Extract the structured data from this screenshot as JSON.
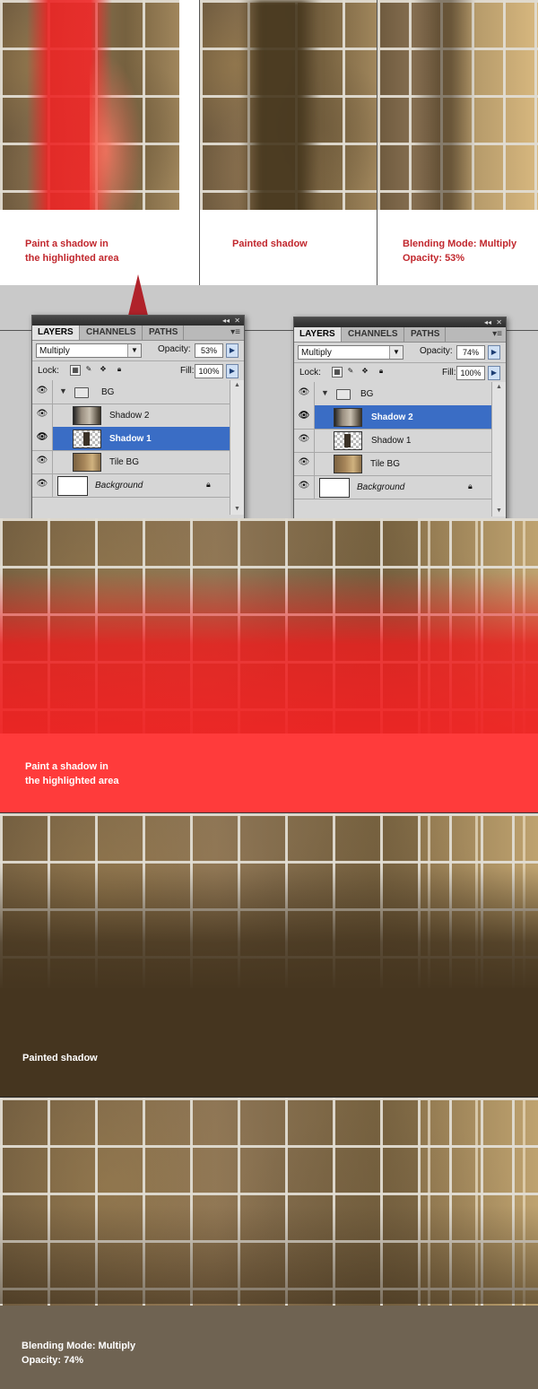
{
  "top_panels": [
    {
      "caption_lines": [
        "Paint a shadow in",
        "the highlighted area"
      ]
    },
    {
      "caption_lines": [
        "Painted shadow"
      ]
    },
    {
      "caption_lines": [
        "Blending Mode: Multiply",
        "Opacity: 53%"
      ]
    }
  ],
  "layers_panel_left": {
    "tabs": [
      "LAYERS",
      "CHANNELS",
      "PATHS"
    ],
    "blend_mode": "Multiply",
    "opacity_label": "Opacity:",
    "opacity": "53%",
    "lock_label": "Lock:",
    "fill_label": "Fill:",
    "fill": "100%",
    "layers": [
      {
        "name": "BG",
        "type": "group"
      },
      {
        "name": "Shadow 2",
        "type": "layer"
      },
      {
        "name": "Shadow 1",
        "type": "layer",
        "selected": true
      },
      {
        "name": "Tile BG",
        "type": "layer"
      },
      {
        "name": "Background",
        "type": "background"
      }
    ]
  },
  "layers_panel_right": {
    "tabs": [
      "LAYERS",
      "CHANNELS",
      "PATHS"
    ],
    "blend_mode": "Multiply",
    "opacity_label": "Opacity:",
    "opacity": "74%",
    "lock_label": "Lock:",
    "fill_label": "Fill:",
    "fill": "100%",
    "layers": [
      {
        "name": "BG",
        "type": "group"
      },
      {
        "name": "Shadow 2",
        "type": "layer",
        "selected": true
      },
      {
        "name": "Shadow 1",
        "type": "layer"
      },
      {
        "name": "Tile BG",
        "type": "layer"
      },
      {
        "name": "Background",
        "type": "background"
      }
    ]
  },
  "big_panels": [
    {
      "caption_lines": [
        "Paint a shadow in",
        "the highlighted area"
      ]
    },
    {
      "caption_lines": [
        "Painted shadow"
      ]
    },
    {
      "caption_lines": [
        "Blending Mode: Multiply",
        "Opacity: 74%"
      ]
    }
  ],
  "colors": {
    "caption_red": "#c1272d",
    "highlight_red": "#ff3b3b",
    "selection_blue": "#3a6dc5",
    "shadow_brown": "#45351f",
    "floor_taupe": "#6f6352"
  }
}
